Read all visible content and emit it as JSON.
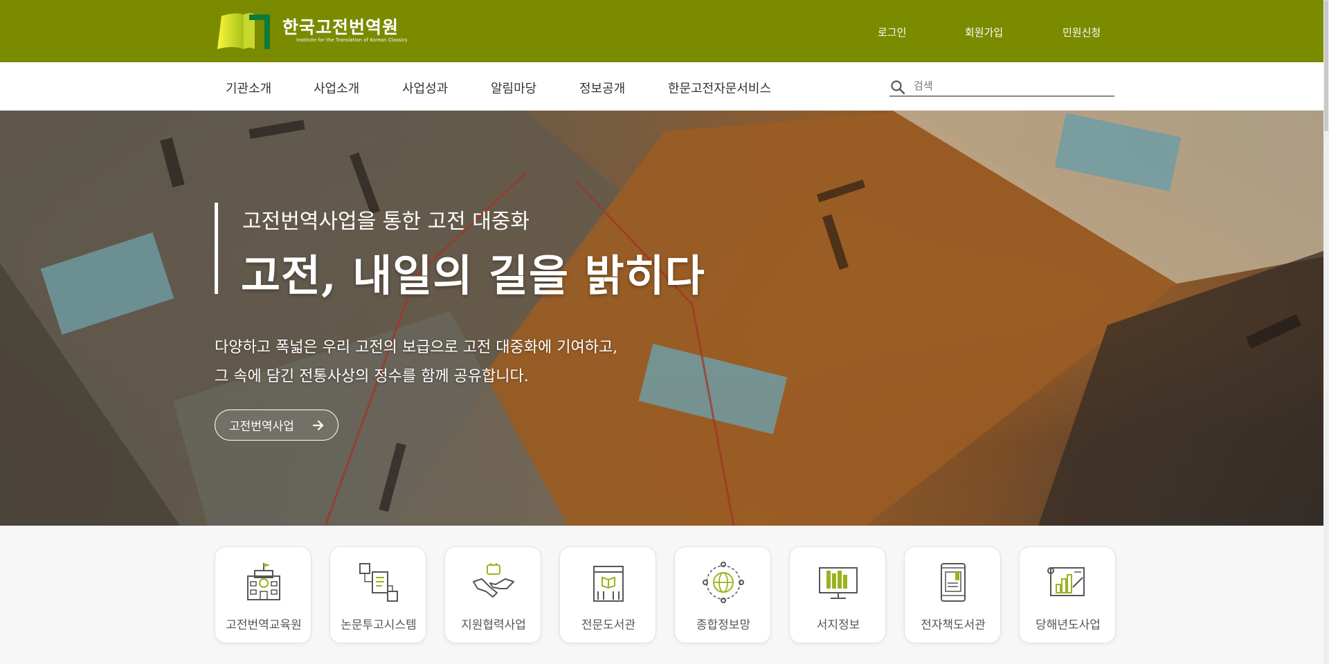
{
  "header": {
    "logo_title": "한국고전번역원",
    "logo_subtitle": "Institute for the Translation of Korean Classics",
    "util_links": {
      "login": "로그인",
      "join": "회원가입",
      "civil": "민원신청"
    },
    "colors": {
      "brand": "#7a8b00",
      "accent": "#9ab31c"
    }
  },
  "nav": {
    "items": [
      "기관소개",
      "사업소개",
      "사업성과",
      "알림마당",
      "정보공개",
      "한문고전자문서비스"
    ],
    "search_placeholder": "검색"
  },
  "hero": {
    "kicker": "고전번역사업을 통한 고전 대중화",
    "title": "고전, 내일의 길을 밝히다",
    "desc_line1": "다양하고 폭넓은 우리 고전의 보급으로 고전 대중화에 기여하고,",
    "desc_line2": "그 속에 담긴 전통사상의 정수를 함께 공유합니다.",
    "button_label": "고전번역사업"
  },
  "quick_menu": {
    "items": [
      {
        "label": "고전번역교육원",
        "icon": "school-building-icon"
      },
      {
        "label": "논문투고시스템",
        "icon": "document-flow-icon"
      },
      {
        "label": "지원협력사업",
        "icon": "handshake-icon"
      },
      {
        "label": "전문도서관",
        "icon": "library-icon"
      },
      {
        "label": "종합정보망",
        "icon": "globe-network-icon"
      },
      {
        "label": "서지정보",
        "icon": "monitor-books-icon"
      },
      {
        "label": "전자책도서관",
        "icon": "tablet-book-icon"
      },
      {
        "label": "당해년도사업",
        "icon": "blueprint-chart-icon"
      }
    ]
  }
}
